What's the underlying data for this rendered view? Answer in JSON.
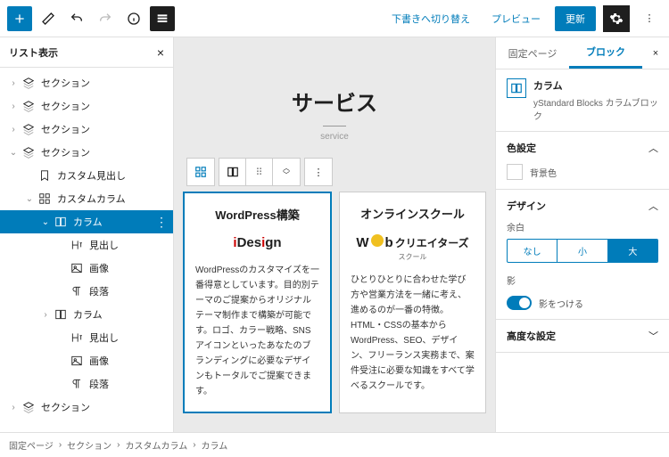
{
  "topbar": {
    "draft": "下書きへ切り替え",
    "preview": "プレビュー",
    "update": "更新"
  },
  "listview": {
    "title": "リスト表示"
  },
  "tree": [
    {
      "l": "セクション",
      "d": 0,
      "c": ">",
      "i": "layers"
    },
    {
      "l": "セクション",
      "d": 0,
      "c": ">",
      "i": "layers"
    },
    {
      "l": "セクション",
      "d": 0,
      "c": ">",
      "i": "layers"
    },
    {
      "l": "セクション",
      "d": 0,
      "c": "v",
      "i": "layers"
    },
    {
      "l": "カスタム見出し",
      "d": 1,
      "c": "",
      "i": "bookmark"
    },
    {
      "l": "カスタムカラム",
      "d": 1,
      "c": "v",
      "i": "grid"
    },
    {
      "l": "カラム",
      "d": 2,
      "c": "v",
      "i": "column",
      "sel": true
    },
    {
      "l": "見出し",
      "d": 3,
      "c": "",
      "i": "heading"
    },
    {
      "l": "画像",
      "d": 3,
      "c": "",
      "i": "image"
    },
    {
      "l": "段落",
      "d": 3,
      "c": "",
      "i": "para"
    },
    {
      "l": "カラム",
      "d": 2,
      "c": ">",
      "i": "column"
    },
    {
      "l": "見出し",
      "d": 3,
      "c": "",
      "i": "heading"
    },
    {
      "l": "画像",
      "d": 3,
      "c": "",
      "i": "image"
    },
    {
      "l": "段落",
      "d": 3,
      "c": "",
      "i": "para"
    },
    {
      "l": "セクション",
      "d": 0,
      "c": ">",
      "i": "layers"
    }
  ],
  "page": {
    "title": "サービス",
    "sub": "service"
  },
  "cards": [
    {
      "title": "WordPress構築",
      "logo": "iDesign",
      "body": "WordPressのカスタマイズを一番得意としています。目的別テーマのご提案からオリジナルテーマ制作まで構築が可能です。ロゴ、カラー戦略、SNSアイコンといったあなたのブランディングに必要なデザインもトータルでご提案できます。"
    },
    {
      "title": "オンラインスクール",
      "logo": "Webクリエイターズ",
      "logoSmall": "スクール",
      "body": "ひとりひとりに合わせた学び方や営業方法を一緒に考え、進めるのが一番の特徴。HTML・CSSの基本からWordPress、SEO、デザイン、フリーランス実務まで、案件受注に必要な知識をすべて学べるスクールです。"
    }
  ],
  "right": {
    "tabs": [
      "固定ページ",
      "ブロック"
    ],
    "blockName": "カラム",
    "blockDesc": "yStandard Blocks カラムブロック",
    "sections": {
      "color": "色設定",
      "bg": "背景色",
      "design": "デザイン",
      "margin": "余白",
      "shadow": "影",
      "shadowLabel": "影をつける",
      "advanced": "高度な設定"
    },
    "seg": [
      "なし",
      "小",
      "大"
    ]
  },
  "breadcrumb": [
    "固定ページ",
    "セクション",
    "カスタムカラム",
    "カラム"
  ]
}
